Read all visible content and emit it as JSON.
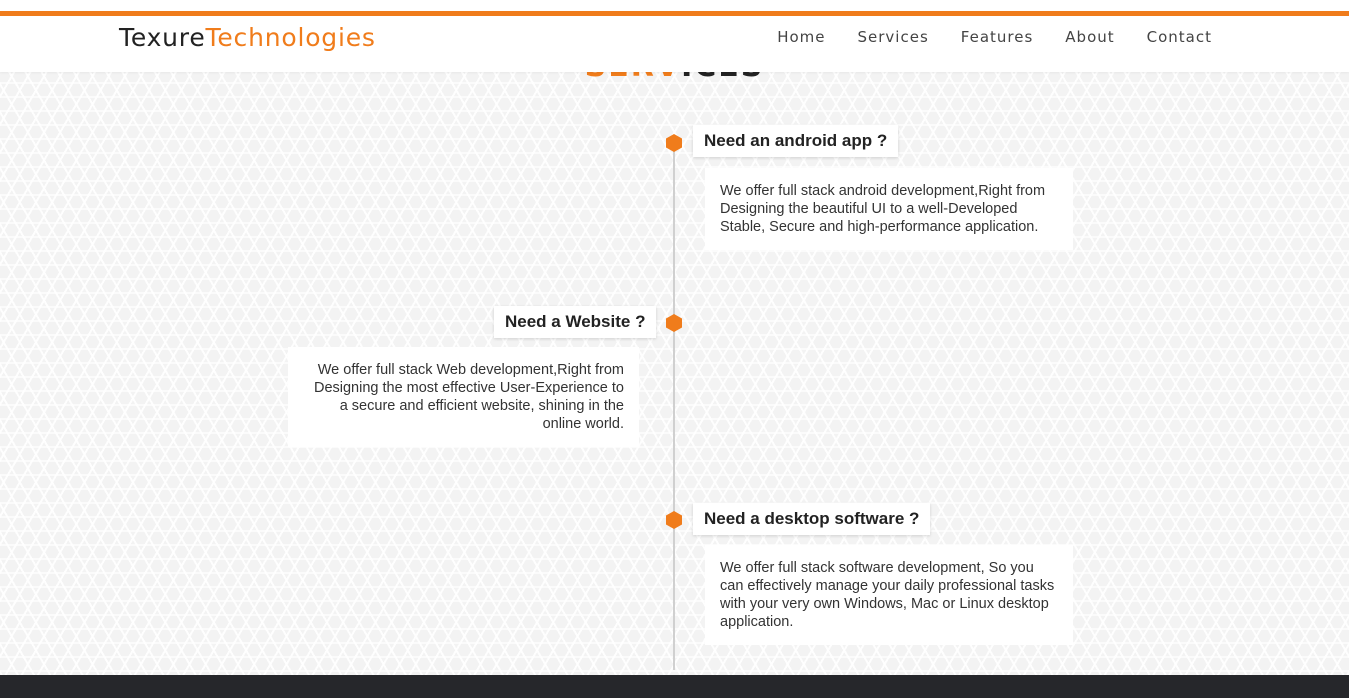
{
  "brand": {
    "part1": "Texure",
    "part2": "Technologies"
  },
  "nav": [
    "Home",
    "Services",
    "Features",
    "About",
    "Contact"
  ],
  "section": {
    "title_part1": "SERV",
    "title_part2": "ICES"
  },
  "timeline": [
    {
      "title": "Need an android app ?",
      "text": "We offer full stack android development,Right from Designing the beautiful UI to a well-Developed Stable, Secure and high-performance application."
    },
    {
      "title": "Need a Website ?",
      "text": "We offer full stack Web development,Right from Designing the most effective User-Experience to a secure and efficient website, shining in the online world."
    },
    {
      "title": "Need a desktop software ?",
      "text": "We offer full stack software development, So you can effectively manage your daily professional tasks with your very own Windows, Mac or Linux desktop application."
    }
  ],
  "colors": {
    "accent": "#f07c1b",
    "footer": "#26272b"
  }
}
